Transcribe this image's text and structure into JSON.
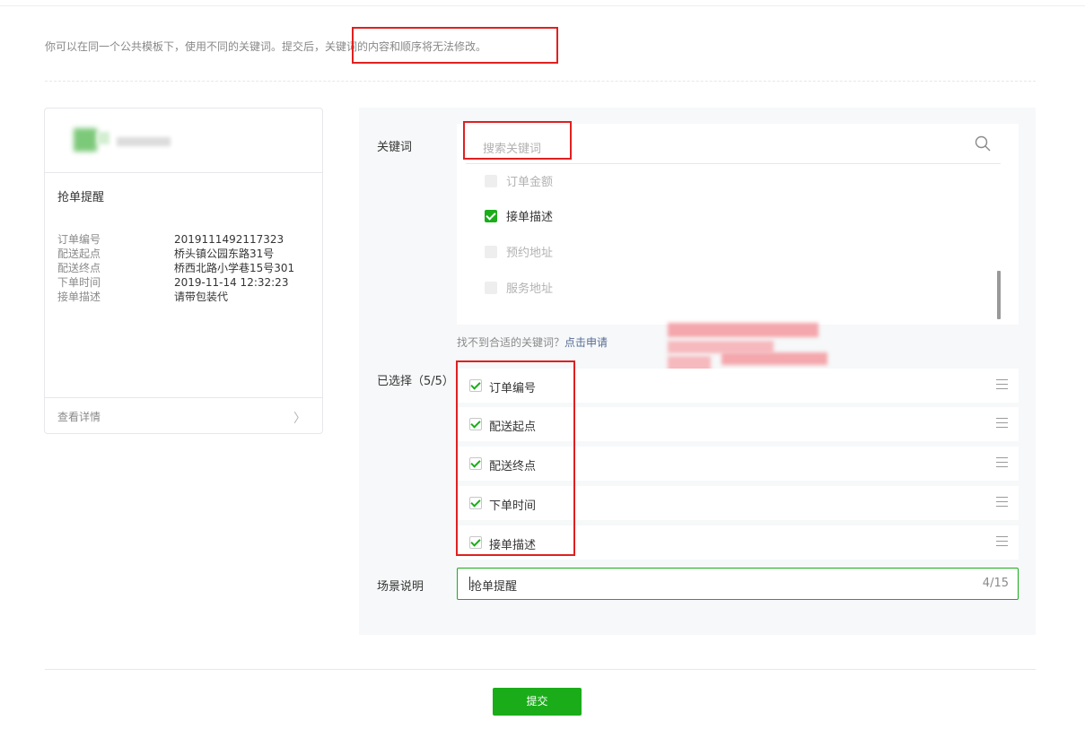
{
  "notice": {
    "prefix": "你可以在同一个公共模板下，使用不同的关键词。提交后，",
    "highlight": "关键词的内容和顺序将无法修改。"
  },
  "preview": {
    "title": "抢单提醒",
    "fields": [
      {
        "key": "订单编号",
        "value": "2019111492117323"
      },
      {
        "key": "配送起点",
        "value": "桥头镇公园东路31号"
      },
      {
        "key": "配送终点",
        "value": "桥西北路小学巷15号301"
      },
      {
        "key": "下单时间",
        "value": "2019-11-14 12:32:23"
      },
      {
        "key": "接单描述",
        "value": "请带包装代"
      }
    ],
    "detail_label": "查看详情",
    "chevron": "〉"
  },
  "form": {
    "keyword_label": "关键词",
    "search_placeholder": "搜索关键词",
    "options": [
      {
        "label": "订单金额",
        "state": "disabled"
      },
      {
        "label": "接单描述",
        "state": "checked"
      },
      {
        "label": "预约地址",
        "state": "disabled"
      },
      {
        "label": "服务地址",
        "state": "disabled"
      }
    ],
    "hint_text": "找不到合适的关键词？",
    "hint_link": "点击申请",
    "selected_label": "已选择（5/5）",
    "selected": [
      "订单编号",
      "配送起点",
      "配送终点",
      "下单时间",
      "接单描述"
    ],
    "scene_label": "场景说明",
    "scene_value": "抢单提醒",
    "scene_count": "4/15"
  },
  "submit_label": "提交",
  "colors": {
    "accent": "#1aad19",
    "annotation": "#e02020",
    "link": "#576b95"
  }
}
